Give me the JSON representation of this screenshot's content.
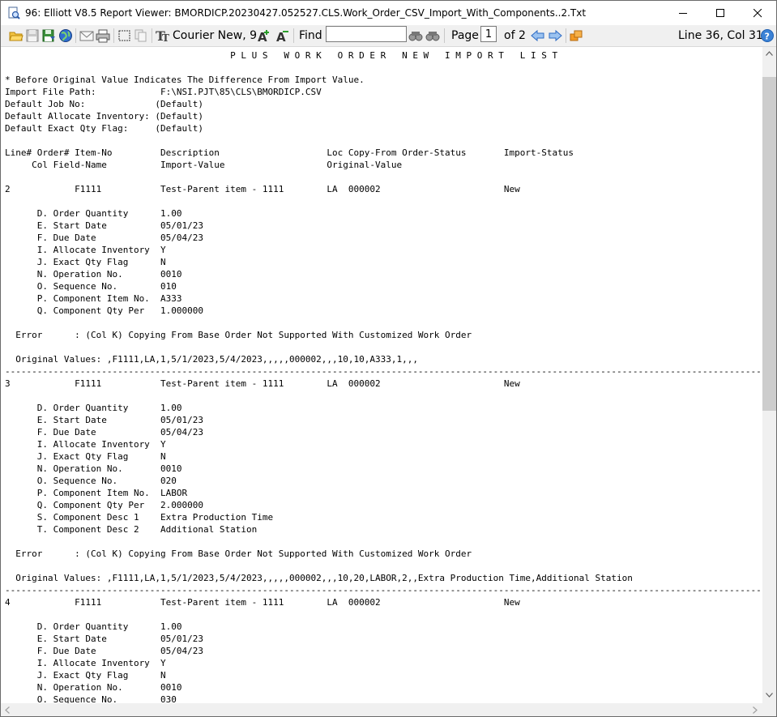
{
  "window": {
    "title": "96: Elliott V8.5 Report Viewer: BMORDICP.20230427.052527.CLS.Work_Order_CSV_Import_With_Components..2.Txt"
  },
  "toolbar": {
    "font_label": "Courier New, 9",
    "find_label": "Find",
    "find_value": "",
    "page_label": "Page",
    "page_value": "1",
    "page_total": "of 2",
    "position": "Line 36, Col 31"
  },
  "report": {
    "lines": [
      "                                          P L U S   W O R K   O R D E R   N E W   I M P O R T   L I S T",
      "",
      "* Before Original Value Indicates The Difference From Import Value.",
      "Import File Path:            F:\\NSI.PJT\\85\\CLS\\BMORDICP.CSV",
      "Default Job No:             (Default)",
      "Default Allocate Inventory: (Default)",
      "Default Exact Qty Flag:     (Default)",
      "",
      "Line# Order# Item-No         Description                    Loc Copy-From Order-Status       Import-Status",
      "     Col Field-Name          Import-Value                   Original-Value",
      "",
      "2            F1111           Test-Parent item - 1111        LA  000002                       New",
      "",
      "      D. Order Quantity      1.00",
      "      E. Start Date          05/01/23",
      "      F. Due Date            05/04/23",
      "      I. Allocate Inventory  Y",
      "      J. Exact Qty Flag      N",
      "      N. Operation No.       0010",
      "      O. Sequence No.        010",
      "      P. Component Item No.  A333",
      "      Q. Component Qty Per   1.000000",
      "",
      "  Error      : (Col K) Copying From Base Order Not Supported With Customized Work Order",
      "",
      "  Original Values: ,F1111,LA,1,5/1/2023,5/4/2023,,,,,000002,,,10,10,A333,1,,,",
      "---------------------------------------------------------------------------------------------------------------------------------------------------",
      "3            F1111           Test-Parent item - 1111        LA  000002                       New",
      "",
      "      D. Order Quantity      1.00",
      "      E. Start Date          05/01/23",
      "      F. Due Date            05/04/23",
      "      I. Allocate Inventory  Y",
      "      J. Exact Qty Flag      N",
      "      N. Operation No.       0010",
      "      O. Sequence No.        020",
      "      P. Component Item No.  LABOR",
      "      Q. Component Qty Per   2.000000",
      "      S. Component Desc 1    Extra Production Time",
      "      T. Component Desc 2    Additional Station",
      "",
      "  Error      : (Col K) Copying From Base Order Not Supported With Customized Work Order",
      "",
      "  Original Values: ,F1111,LA,1,5/1/2023,5/4/2023,,,,,000002,,,10,20,LABOR,2,,Extra Production Time,Additional Station",
      "---------------------------------------------------------------------------------------------------------------------------------------------------",
      "4            F1111           Test-Parent item - 1111        LA  000002                       New",
      "",
      "      D. Order Quantity      1.00",
      "      E. Start Date          05/01/23",
      "      F. Due Date            05/04/23",
      "      I. Allocate Inventory  Y",
      "      J. Exact Qty Flag      N",
      "      N. Operation No.       0010",
      "      O. Sequence No.        030"
    ]
  }
}
